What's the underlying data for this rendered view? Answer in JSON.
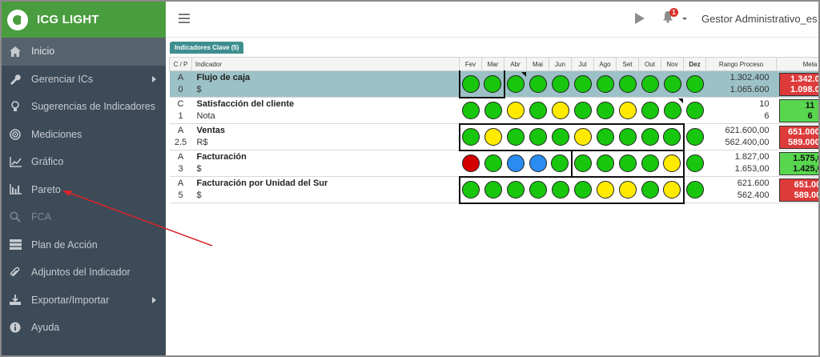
{
  "app": {
    "brand": "ICG LIGHT"
  },
  "sidebar": {
    "items": [
      {
        "label": "Inicio",
        "icon": "home-icon",
        "active": true
      },
      {
        "label": "Gerenciar ICs",
        "icon": "wrench-icon",
        "has_submenu": true
      },
      {
        "label": "Sugerencias de Indicadores",
        "icon": "lightbulb-icon"
      },
      {
        "label": "Mediciones",
        "icon": "target-icon"
      },
      {
        "label": "Gráfico",
        "icon": "line-chart-icon"
      },
      {
        "label": "Pareto",
        "icon": "bar-chart-icon"
      },
      {
        "label": "FCA",
        "icon": "search-icon",
        "disabled": true
      },
      {
        "label": "Plan de Acción",
        "icon": "server-icon"
      },
      {
        "label": "Adjuntos del Indicador",
        "icon": "paperclip-icon"
      },
      {
        "label": "Exportar/Importar",
        "icon": "download-icon",
        "has_submenu": true
      },
      {
        "label": "Ayuda",
        "icon": "info-icon"
      }
    ]
  },
  "header": {
    "notifications_count": "1",
    "user": "Gestor Administrativo_es"
  },
  "kpi_tab": "Indicadores Clave (5)",
  "table": {
    "columns": {
      "cp": "C / P",
      "indicator": "Indicador",
      "months": [
        "Fev",
        "Mar",
        "Abr",
        "Mai",
        "Jun",
        "Jul",
        "Ago",
        "Set",
        "Out",
        "Nov",
        "Dez"
      ],
      "range": "Rango Proceso",
      "goal": "Meta"
    },
    "rows": [
      {
        "cp_top": "A",
        "cp_bottom": "0",
        "name": "Flujo de caja",
        "unit": "$",
        "status": [
          "green",
          "green",
          "green",
          "green",
          "green",
          "green",
          "green",
          "green",
          "green",
          "green",
          "green"
        ],
        "range_top": "1.302.400",
        "range_bottom": "1.065.600",
        "goal_top": "1.342.000",
        "goal_bottom": "1.098.000",
        "goal_color": "red",
        "selected": true
      },
      {
        "cp_top": "C",
        "cp_bottom": "1",
        "name": "Satisfacción del cliente",
        "unit": "Nota",
        "status": [
          "green",
          "green",
          "yellow",
          "green",
          "yellow",
          "green",
          "green",
          "yellow",
          "green",
          "green",
          "green"
        ],
        "range_top": "10",
        "range_bottom": "6",
        "goal_top": "11",
        "goal_bottom": "6",
        "goal_color": "green"
      },
      {
        "cp_top": "A",
        "cp_bottom": "2.5",
        "name": "Ventas",
        "unit": "R$",
        "status": [
          "green",
          "yellow",
          "green",
          "green",
          "green",
          "yellow",
          "green",
          "green",
          "green",
          "green",
          "green"
        ],
        "range_top": "621.600,00",
        "range_bottom": "562.400,00",
        "goal_top": "651.000,00",
        "goal_bottom": "589.000,00",
        "goal_color": "red"
      },
      {
        "cp_top": "A",
        "cp_bottom": "3",
        "name": "Facturación",
        "unit": "$",
        "status": [
          "red",
          "green",
          "blue",
          "blue",
          "green",
          "green",
          "green",
          "green",
          "green",
          "yellow",
          "green"
        ],
        "range_top": "1.827,00",
        "range_bottom": "1.653,00",
        "goal_top": "1.575,00",
        "goal_bottom": "1.425,00",
        "goal_color": "green"
      },
      {
        "cp_top": "A",
        "cp_bottom": "5",
        "name": "Facturación por Unidad del Sur",
        "unit": "$",
        "status": [
          "green",
          "green",
          "green",
          "green",
          "green",
          "green",
          "yellow",
          "yellow",
          "green",
          "yellow",
          "green"
        ],
        "range_top": "621.600",
        "range_bottom": "562.400",
        "goal_top": "651.000",
        "goal_bottom": "589.000",
        "goal_color": "red"
      }
    ]
  },
  "colors": {
    "sidebar_bg": "#3d4a57",
    "brand_bg": "#4a9d3f",
    "selected_row": "#9cc1c6",
    "status_green": "#17c60d",
    "status_yellow": "#ffea00",
    "status_red": "#d40000",
    "status_blue": "#2a8cf0",
    "goal_red": "#dd3a3a",
    "goal_green": "#58d64e",
    "annotation_arrow": "#d9252a"
  }
}
